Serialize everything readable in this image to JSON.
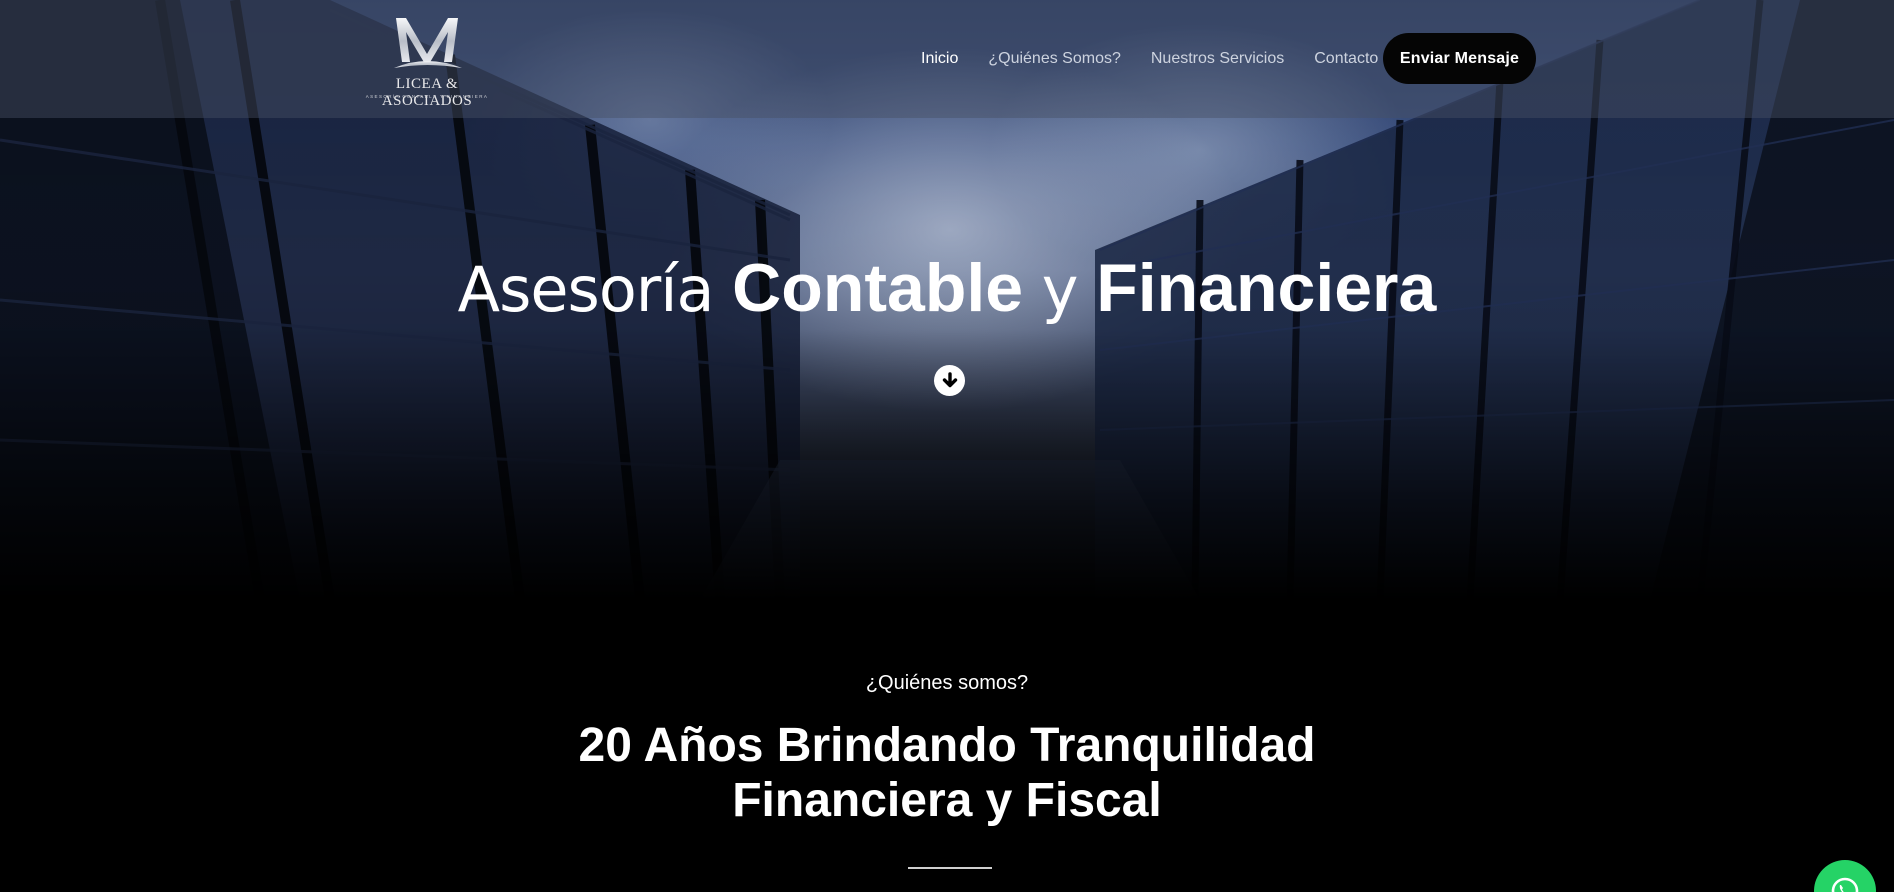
{
  "brand": {
    "name": "LICEA & ASOCIADOS",
    "tagline": "ASESORÍA CONTABLE Y FINANCIERA"
  },
  "nav": {
    "items": [
      {
        "label": "Inicio",
        "active": true
      },
      {
        "label": "¿Quiénes Somos?",
        "active": false
      },
      {
        "label": "Nuestros Servicios",
        "active": false
      },
      {
        "label": "Contacto",
        "active": false
      }
    ],
    "cta_label": "Enviar Mensaje"
  },
  "hero": {
    "title_part1": "Asesoría ",
    "title_part2": "Contable",
    "title_part3": " y ",
    "title_part4": "Financiera",
    "scroll_icon": "arrow-down-circle-icon"
  },
  "about": {
    "kicker": "¿Quiénes somos?",
    "title_line1": "20 Años Brindando Tranquilidad",
    "title_line2": "Financiera y Fiscal"
  },
  "colors": {
    "cta_bg": "#050505",
    "whatsapp": "#25d366",
    "page_bg": "#000000"
  }
}
